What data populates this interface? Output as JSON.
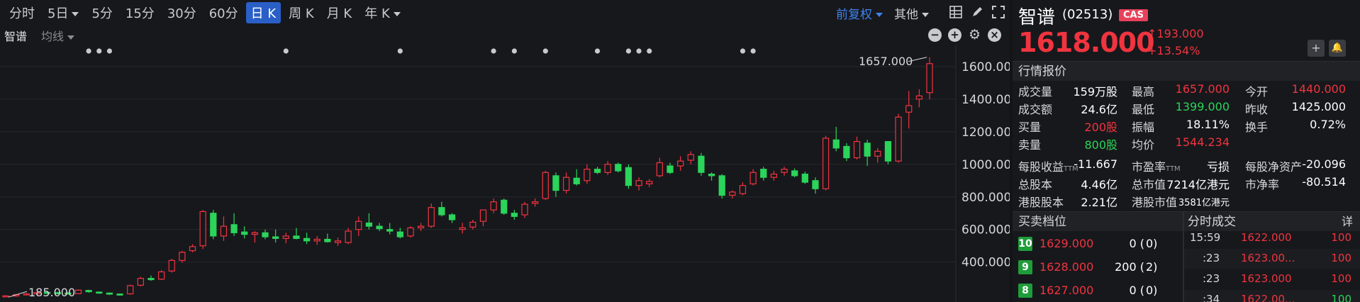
{
  "period_tabs": [
    {
      "label": "分时",
      "has_caret": false,
      "active": false
    },
    {
      "label": "5日",
      "has_caret": true,
      "active": false
    },
    {
      "label": "5分",
      "has_caret": false,
      "active": false
    },
    {
      "label": "15分",
      "has_caret": false,
      "active": false
    },
    {
      "label": "30分",
      "has_caret": false,
      "active": false
    },
    {
      "label": "60分",
      "has_caret": false,
      "active": false
    },
    {
      "label": "日 K",
      "has_caret": false,
      "active": true
    },
    {
      "label": "周 K",
      "has_caret": false,
      "active": false
    },
    {
      "label": "月 K",
      "has_caret": false,
      "active": false
    },
    {
      "label": "年 K",
      "has_caret": true,
      "active": false
    }
  ],
  "toolbar": {
    "adjust_label": "前复权",
    "other_label": "其他"
  },
  "indicator_bar": {
    "stock_label": "智谱",
    "ma_label": "均线"
  },
  "chart_data": {
    "type": "candlestick",
    "y_ticks": [
      "1600.000",
      "1400.000",
      "1200.000",
      "1000.000",
      "800.000",
      "600.000",
      "400.000"
    ],
    "y_tick_values": [
      1600,
      1400,
      1200,
      1000,
      800,
      600,
      400
    ],
    "ylim": [
      155,
      1730
    ],
    "high_label": "1657.000",
    "low_label": "185.000",
    "colors": {
      "up": "#f0343f",
      "down": "#2bd45a",
      "grid": "#26282c",
      "text": "#d6d7da",
      "dot": "#c9cacd"
    },
    "candles": [
      {
        "o": 190,
        "h": 196,
        "l": 185,
        "c": 193
      },
      {
        "o": 192,
        "h": 205,
        "l": 188,
        "c": 200
      },
      {
        "o": 200,
        "h": 210,
        "l": 195,
        "c": 205
      },
      {
        "o": 205,
        "h": 218,
        "l": 200,
        "c": 213
      },
      {
        "o": 214,
        "h": 222,
        "l": 206,
        "c": 210
      },
      {
        "o": 212,
        "h": 218,
        "l": 203,
        "c": 208
      },
      {
        "o": 210,
        "h": 216,
        "l": 202,
        "c": 205
      },
      {
        "o": 206,
        "h": 232,
        "l": 203,
        "c": 228
      },
      {
        "o": 226,
        "h": 230,
        "l": 212,
        "c": 218
      },
      {
        "o": 216,
        "h": 219,
        "l": 205,
        "c": 210
      },
      {
        "o": 210,
        "h": 213,
        "l": 198,
        "c": 203
      },
      {
        "o": 204,
        "h": 208,
        "l": 195,
        "c": 202
      },
      {
        "o": 205,
        "h": 262,
        "l": 200,
        "c": 255
      },
      {
        "o": 258,
        "h": 310,
        "l": 250,
        "c": 300
      },
      {
        "o": 300,
        "h": 318,
        "l": 285,
        "c": 292
      },
      {
        "o": 295,
        "h": 350,
        "l": 290,
        "c": 340
      },
      {
        "o": 345,
        "h": 420,
        "l": 335,
        "c": 410
      },
      {
        "o": 410,
        "h": 470,
        "l": 395,
        "c": 460
      },
      {
        "o": 470,
        "h": 510,
        "l": 460,
        "c": 495
      },
      {
        "o": 500,
        "h": 720,
        "l": 480,
        "c": 710
      },
      {
        "o": 700,
        "h": 720,
        "l": 540,
        "c": 560
      },
      {
        "o": 560,
        "h": 680,
        "l": 530,
        "c": 620
      },
      {
        "o": 630,
        "h": 700,
        "l": 560,
        "c": 580
      },
      {
        "o": 585,
        "h": 620,
        "l": 545,
        "c": 570
      },
      {
        "o": 570,
        "h": 590,
        "l": 520,
        "c": 580
      },
      {
        "o": 580,
        "h": 600,
        "l": 540,
        "c": 555
      },
      {
        "o": 555,
        "h": 600,
        "l": 520,
        "c": 545
      },
      {
        "o": 545,
        "h": 580,
        "l": 515,
        "c": 560
      },
      {
        "o": 560,
        "h": 610,
        "l": 540,
        "c": 545
      },
      {
        "o": 545,
        "h": 580,
        "l": 510,
        "c": 530
      },
      {
        "o": 530,
        "h": 560,
        "l": 505,
        "c": 540
      },
      {
        "o": 540,
        "h": 575,
        "l": 520,
        "c": 525
      },
      {
        "o": 520,
        "h": 550,
        "l": 500,
        "c": 530
      },
      {
        "o": 520,
        "h": 610,
        "l": 510,
        "c": 590
      },
      {
        "o": 600,
        "h": 680,
        "l": 560,
        "c": 650
      },
      {
        "o": 640,
        "h": 700,
        "l": 600,
        "c": 620
      },
      {
        "o": 620,
        "h": 640,
        "l": 590,
        "c": 605
      },
      {
        "o": 600,
        "h": 640,
        "l": 570,
        "c": 590
      },
      {
        "o": 585,
        "h": 610,
        "l": 545,
        "c": 555
      },
      {
        "o": 560,
        "h": 620,
        "l": 550,
        "c": 610
      },
      {
        "o": 610,
        "h": 640,
        "l": 590,
        "c": 620
      },
      {
        "o": 620,
        "h": 760,
        "l": 610,
        "c": 735
      },
      {
        "o": 735,
        "h": 770,
        "l": 680,
        "c": 690
      },
      {
        "o": 690,
        "h": 700,
        "l": 640,
        "c": 660
      },
      {
        "o": 600,
        "h": 640,
        "l": 575,
        "c": 610
      },
      {
        "o": 615,
        "h": 660,
        "l": 600,
        "c": 645
      },
      {
        "o": 650,
        "h": 710,
        "l": 620,
        "c": 720
      },
      {
        "o": 720,
        "h": 790,
        "l": 700,
        "c": 770
      },
      {
        "o": 780,
        "h": 790,
        "l": 690,
        "c": 700
      },
      {
        "o": 700,
        "h": 720,
        "l": 660,
        "c": 680
      },
      {
        "o": 690,
        "h": 770,
        "l": 670,
        "c": 755
      },
      {
        "o": 760,
        "h": 790,
        "l": 740,
        "c": 770
      },
      {
        "o": 790,
        "h": 960,
        "l": 780,
        "c": 950
      },
      {
        "o": 930,
        "h": 950,
        "l": 800,
        "c": 840
      },
      {
        "o": 840,
        "h": 950,
        "l": 820,
        "c": 920
      },
      {
        "o": 915,
        "h": 970,
        "l": 870,
        "c": 880
      },
      {
        "o": 900,
        "h": 1000,
        "l": 880,
        "c": 970
      },
      {
        "o": 970,
        "h": 985,
        "l": 940,
        "c": 950
      },
      {
        "o": 950,
        "h": 1020,
        "l": 935,
        "c": 1000
      },
      {
        "o": 1000,
        "h": 1010,
        "l": 950,
        "c": 960
      },
      {
        "o": 980,
        "h": 1000,
        "l": 850,
        "c": 870
      },
      {
        "o": 870,
        "h": 920,
        "l": 840,
        "c": 900
      },
      {
        "o": 880,
        "h": 910,
        "l": 860,
        "c": 895
      },
      {
        "o": 930,
        "h": 1040,
        "l": 920,
        "c": 1010
      },
      {
        "o": 990,
        "h": 1010,
        "l": 940,
        "c": 950
      },
      {
        "o": 990,
        "h": 1050,
        "l": 960,
        "c": 1020
      },
      {
        "o": 1025,
        "h": 1080,
        "l": 1000,
        "c": 1060
      },
      {
        "o": 1050,
        "h": 1070,
        "l": 930,
        "c": 950
      },
      {
        "o": 940,
        "h": 950,
        "l": 900,
        "c": 930
      },
      {
        "o": 930,
        "h": 940,
        "l": 790,
        "c": 810
      },
      {
        "o": 810,
        "h": 840,
        "l": 790,
        "c": 830
      },
      {
        "o": 820,
        "h": 890,
        "l": 810,
        "c": 870
      },
      {
        "o": 880,
        "h": 970,
        "l": 870,
        "c": 950
      },
      {
        "o": 970,
        "h": 985,
        "l": 900,
        "c": 920
      },
      {
        "o": 920,
        "h": 960,
        "l": 900,
        "c": 940
      },
      {
        "o": 950,
        "h": 985,
        "l": 930,
        "c": 970
      },
      {
        "o": 960,
        "h": 975,
        "l": 920,
        "c": 930
      },
      {
        "o": 940,
        "h": 955,
        "l": 880,
        "c": 890
      },
      {
        "o": 900,
        "h": 920,
        "l": 820,
        "c": 850
      },
      {
        "o": 850,
        "h": 1175,
        "l": 840,
        "c": 1160
      },
      {
        "o": 1150,
        "h": 1230,
        "l": 1080,
        "c": 1100
      },
      {
        "o": 1110,
        "h": 1130,
        "l": 1020,
        "c": 1040
      },
      {
        "o": 1040,
        "h": 1170,
        "l": 1030,
        "c": 1140
      },
      {
        "o": 1130,
        "h": 1150,
        "l": 990,
        "c": 1050
      },
      {
        "o": 1050,
        "h": 1100,
        "l": 1010,
        "c": 1080
      },
      {
        "o": 1140,
        "h": 1140,
        "l": 1000,
        "c": 1020
      },
      {
        "o": 1020,
        "h": 1310,
        "l": 1010,
        "c": 1290
      },
      {
        "o": 1320,
        "h": 1450,
        "l": 1220,
        "c": 1360
      },
      {
        "o": 1400,
        "h": 1460,
        "l": 1350,
        "c": 1420
      },
      {
        "o": 1440,
        "h": 1657,
        "l": 1399,
        "c": 1618
      }
    ],
    "marker_candles": [
      8,
      9,
      10,
      27,
      38,
      47,
      49,
      52,
      57,
      60,
      61,
      62,
      71,
      72
    ]
  },
  "quote": {
    "name": "智谱",
    "code": "(02513)",
    "badge": "CAS",
    "price": "1618.000",
    "change_abs": "↑193.000",
    "change_pct": "+13.54%",
    "btn_add": "+",
    "btn_alert": "🔔"
  },
  "sections": {
    "market_quote": "行情报价",
    "depth": "买卖档位",
    "ticks": "分时成交",
    "detail": "详"
  },
  "quote_rows": [
    [
      {
        "label": "成交量",
        "value": "159万股",
        "color": ""
      },
      {
        "label": "最高",
        "value": "1657.000",
        "color": "red"
      },
      {
        "label": "今开",
        "value": "1440.000",
        "color": "red"
      }
    ],
    [
      {
        "label": "成交额",
        "value": "24.6亿",
        "color": ""
      },
      {
        "label": "最低",
        "value": "1399.000",
        "color": "green"
      },
      {
        "label": "昨收",
        "value": "1425.000",
        "color": ""
      }
    ],
    [
      {
        "label": "买量",
        "value": "200股",
        "color": "red"
      },
      {
        "label": "振幅",
        "value": "18.11%",
        "color": ""
      },
      {
        "label": "换手",
        "value": "0.72%",
        "color": ""
      }
    ],
    [
      {
        "label": "卖量",
        "value": "800股",
        "color": "green"
      },
      {
        "label": "均价",
        "value": "1544.234",
        "color": "red"
      },
      {
        "label": "",
        "value": "",
        "color": ""
      }
    ],
    [
      {
        "label": "每股收益",
        "ttm": "TTM",
        "value": "-11.667",
        "color": ""
      },
      {
        "label": "市盈率",
        "ttm": "TTM",
        "value": "亏损",
        "color": ""
      },
      {
        "label": "每股净资产",
        "value": "-20.096",
        "color": ""
      }
    ],
    [
      {
        "label": "总股本",
        "value": "4.46亿",
        "color": ""
      },
      {
        "label": "总市值",
        "value": "7214亿港元",
        "color": ""
      },
      {
        "label": "市净率",
        "value": "-80.514",
        "color": ""
      }
    ],
    [
      {
        "label": "港股股本",
        "value": "2.21亿",
        "color": ""
      },
      {
        "label": "港股市值",
        "value": "3581亿港元",
        "color": ""
      },
      {
        "label": "",
        "value": "",
        "color": ""
      }
    ]
  ],
  "depth": [
    {
      "level": "10",
      "price": "1629.000",
      "volume": "0 (",
      "count": "0)"
    },
    {
      "level": "9",
      "price": "1628.000",
      "volume": "200 (",
      "count": "2)"
    },
    {
      "level": "8",
      "price": "1627.000",
      "volume": "0 (",
      "count": "0)"
    }
  ],
  "ticks": [
    {
      "time": "15:59",
      "price": "1622.000",
      "volume": "100",
      "vol_color": "red"
    },
    {
      "time": ":23",
      "price": "1623.00...",
      "volume": "100",
      "vol_color": "red"
    },
    {
      "time": ":23",
      "price": "1623.000",
      "volume": "100",
      "vol_color": "red"
    },
    {
      "time": ":34",
      "price": "1622.00...",
      "volume": "100",
      "vol_color": "green"
    }
  ]
}
